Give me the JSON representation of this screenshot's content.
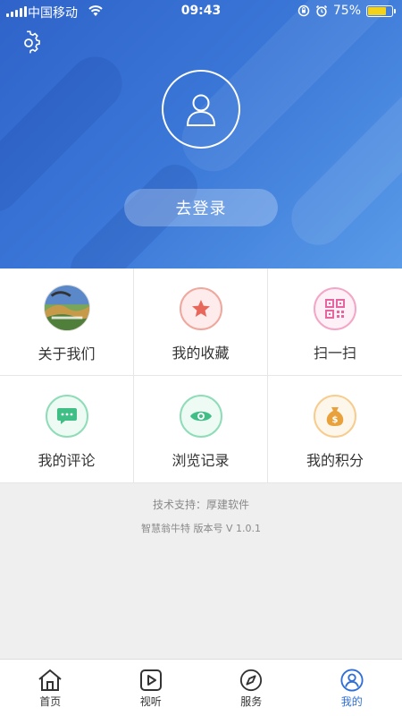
{
  "status_bar": {
    "carrier": "中国移动",
    "time": "09:43",
    "battery": "75%",
    "battery_level": 0.75
  },
  "header": {
    "login_label": "去登录"
  },
  "grid": [
    {
      "label": "关于我们",
      "icon": "about-logo"
    },
    {
      "label": "我的收藏",
      "icon": "star-icon"
    },
    {
      "label": "扫一扫",
      "icon": "qr-code-icon"
    },
    {
      "label": "我的评论",
      "icon": "comment-icon"
    },
    {
      "label": "浏览记录",
      "icon": "eye-icon"
    },
    {
      "label": "我的积分",
      "icon": "money-bag-icon"
    }
  ],
  "footer": {
    "tech_support": "技术支持：厚建软件",
    "version": "智慧翁牛特 版本号 V 1.0.1"
  },
  "tabbar": [
    {
      "label": "首页",
      "icon": "home-icon"
    },
    {
      "label": "视听",
      "icon": "play-icon"
    },
    {
      "label": "服务",
      "icon": "compass-icon"
    },
    {
      "label": "我的",
      "icon": "profile-icon",
      "active": true
    }
  ],
  "colors": {
    "accent": "#2f6fd6",
    "star": "#e8675b",
    "qr": "#e5669e",
    "green": "#3fbf85",
    "gold": "#e8a13b"
  }
}
